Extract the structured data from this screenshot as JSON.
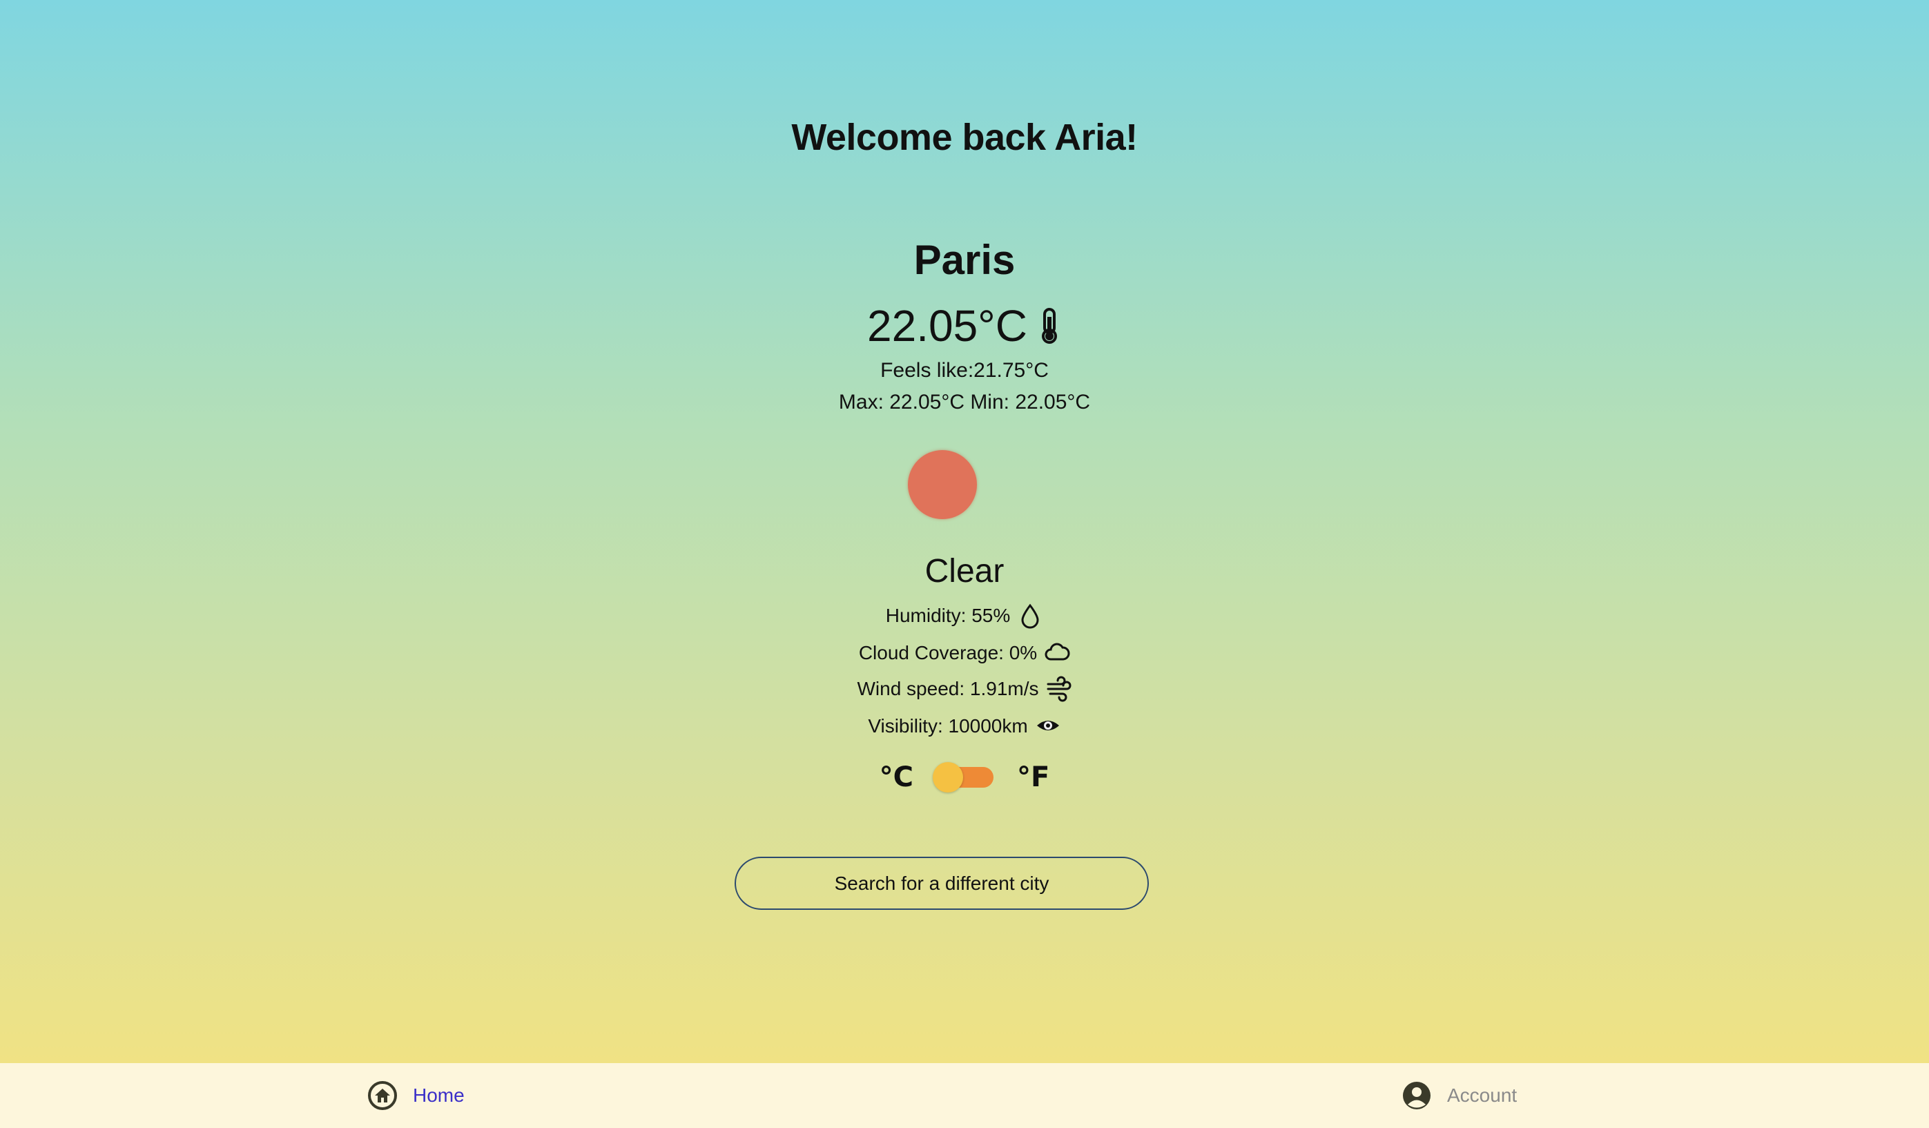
{
  "header": {
    "welcome": "Welcome back Aria!"
  },
  "weather": {
    "city": "Paris",
    "temperature": "22.05°C",
    "feels_like": "Feels like:21.75°C",
    "max_min": "Max: 22.05°C Min: 22.05°C",
    "condition": "Clear",
    "humidity": "Humidity: 55%",
    "cloud_coverage": "Cloud Coverage: 0%",
    "wind_speed": "Wind speed: 1.91m/s",
    "visibility": "Visibility: 10000km",
    "icons": {
      "temperature": "thermometer-icon",
      "humidity": "droplet-icon",
      "cloud": "cloud-icon",
      "wind": "wind-icon",
      "visibility": "eye-icon",
      "condition": "sun-icon"
    },
    "sun_color": "#e0735a"
  },
  "unit_toggle": {
    "celsius_label": "°C",
    "fahrenheit_label": "°F",
    "selected": "celsius",
    "track_color": "#ee8a36",
    "knob_color": "#f5c142"
  },
  "search": {
    "button_label": "Search for a different city"
  },
  "bottom_nav": {
    "items": [
      {
        "label": "Home",
        "icon": "home-icon",
        "active": true,
        "color": "#3b30c8"
      },
      {
        "label": "Account",
        "icon": "account-icon",
        "active": false,
        "color": "#8a8a8a"
      }
    ]
  }
}
